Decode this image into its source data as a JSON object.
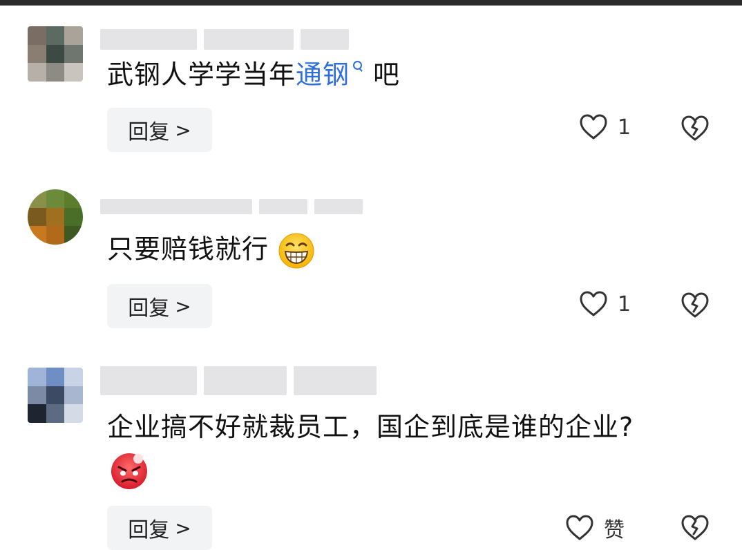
{
  "comments": [
    {
      "text_before": "武钢人学学当年",
      "link_text": "通钢",
      "text_after": "吧",
      "reply_label": "回复",
      "reply_arrow": ">",
      "like_count": "1",
      "avatar_colors": [
        "#7a6e64",
        "#5b6b61",
        "#a9a39a",
        "#8a7d72",
        "#3d4a44",
        "#6f7670",
        "#b7b0a8",
        "#8e8a84",
        "#c9c4bd"
      ]
    },
    {
      "text": "只要赔钱就行",
      "emoji": "grinning-face",
      "reply_label": "回复",
      "reply_arrow": ">",
      "like_count": "1",
      "avatar_colors": [
        "#8a8f4a",
        "#6b8a3a",
        "#5a7d2e",
        "#7a5a1e",
        "#a07020",
        "#4a6e28",
        "#c8781e",
        "#b06a1a",
        "#3e5a22"
      ]
    },
    {
      "text": "企业搞不好就裁员工，国企到底是谁的企业?",
      "emoji": "angry-face",
      "reply_label": "回复",
      "reply_arrow": ">",
      "like_label": "赞",
      "avatar_colors": [
        "#9fb4d6",
        "#6f8fc4",
        "#c9d3e6",
        "#7c8aa6",
        "#3c4a63",
        "#a8b6cf",
        "#1f2530",
        "#5d6b82",
        "#d5dbe6"
      ]
    }
  ],
  "icons": {
    "like": "heart-outline-icon",
    "dislike": "broken-heart-icon",
    "search": "search-icon"
  },
  "colors": {
    "link": "#2f6fdb",
    "reply_bg": "#f2f3f5",
    "placeholder": "#e4e4e6"
  }
}
